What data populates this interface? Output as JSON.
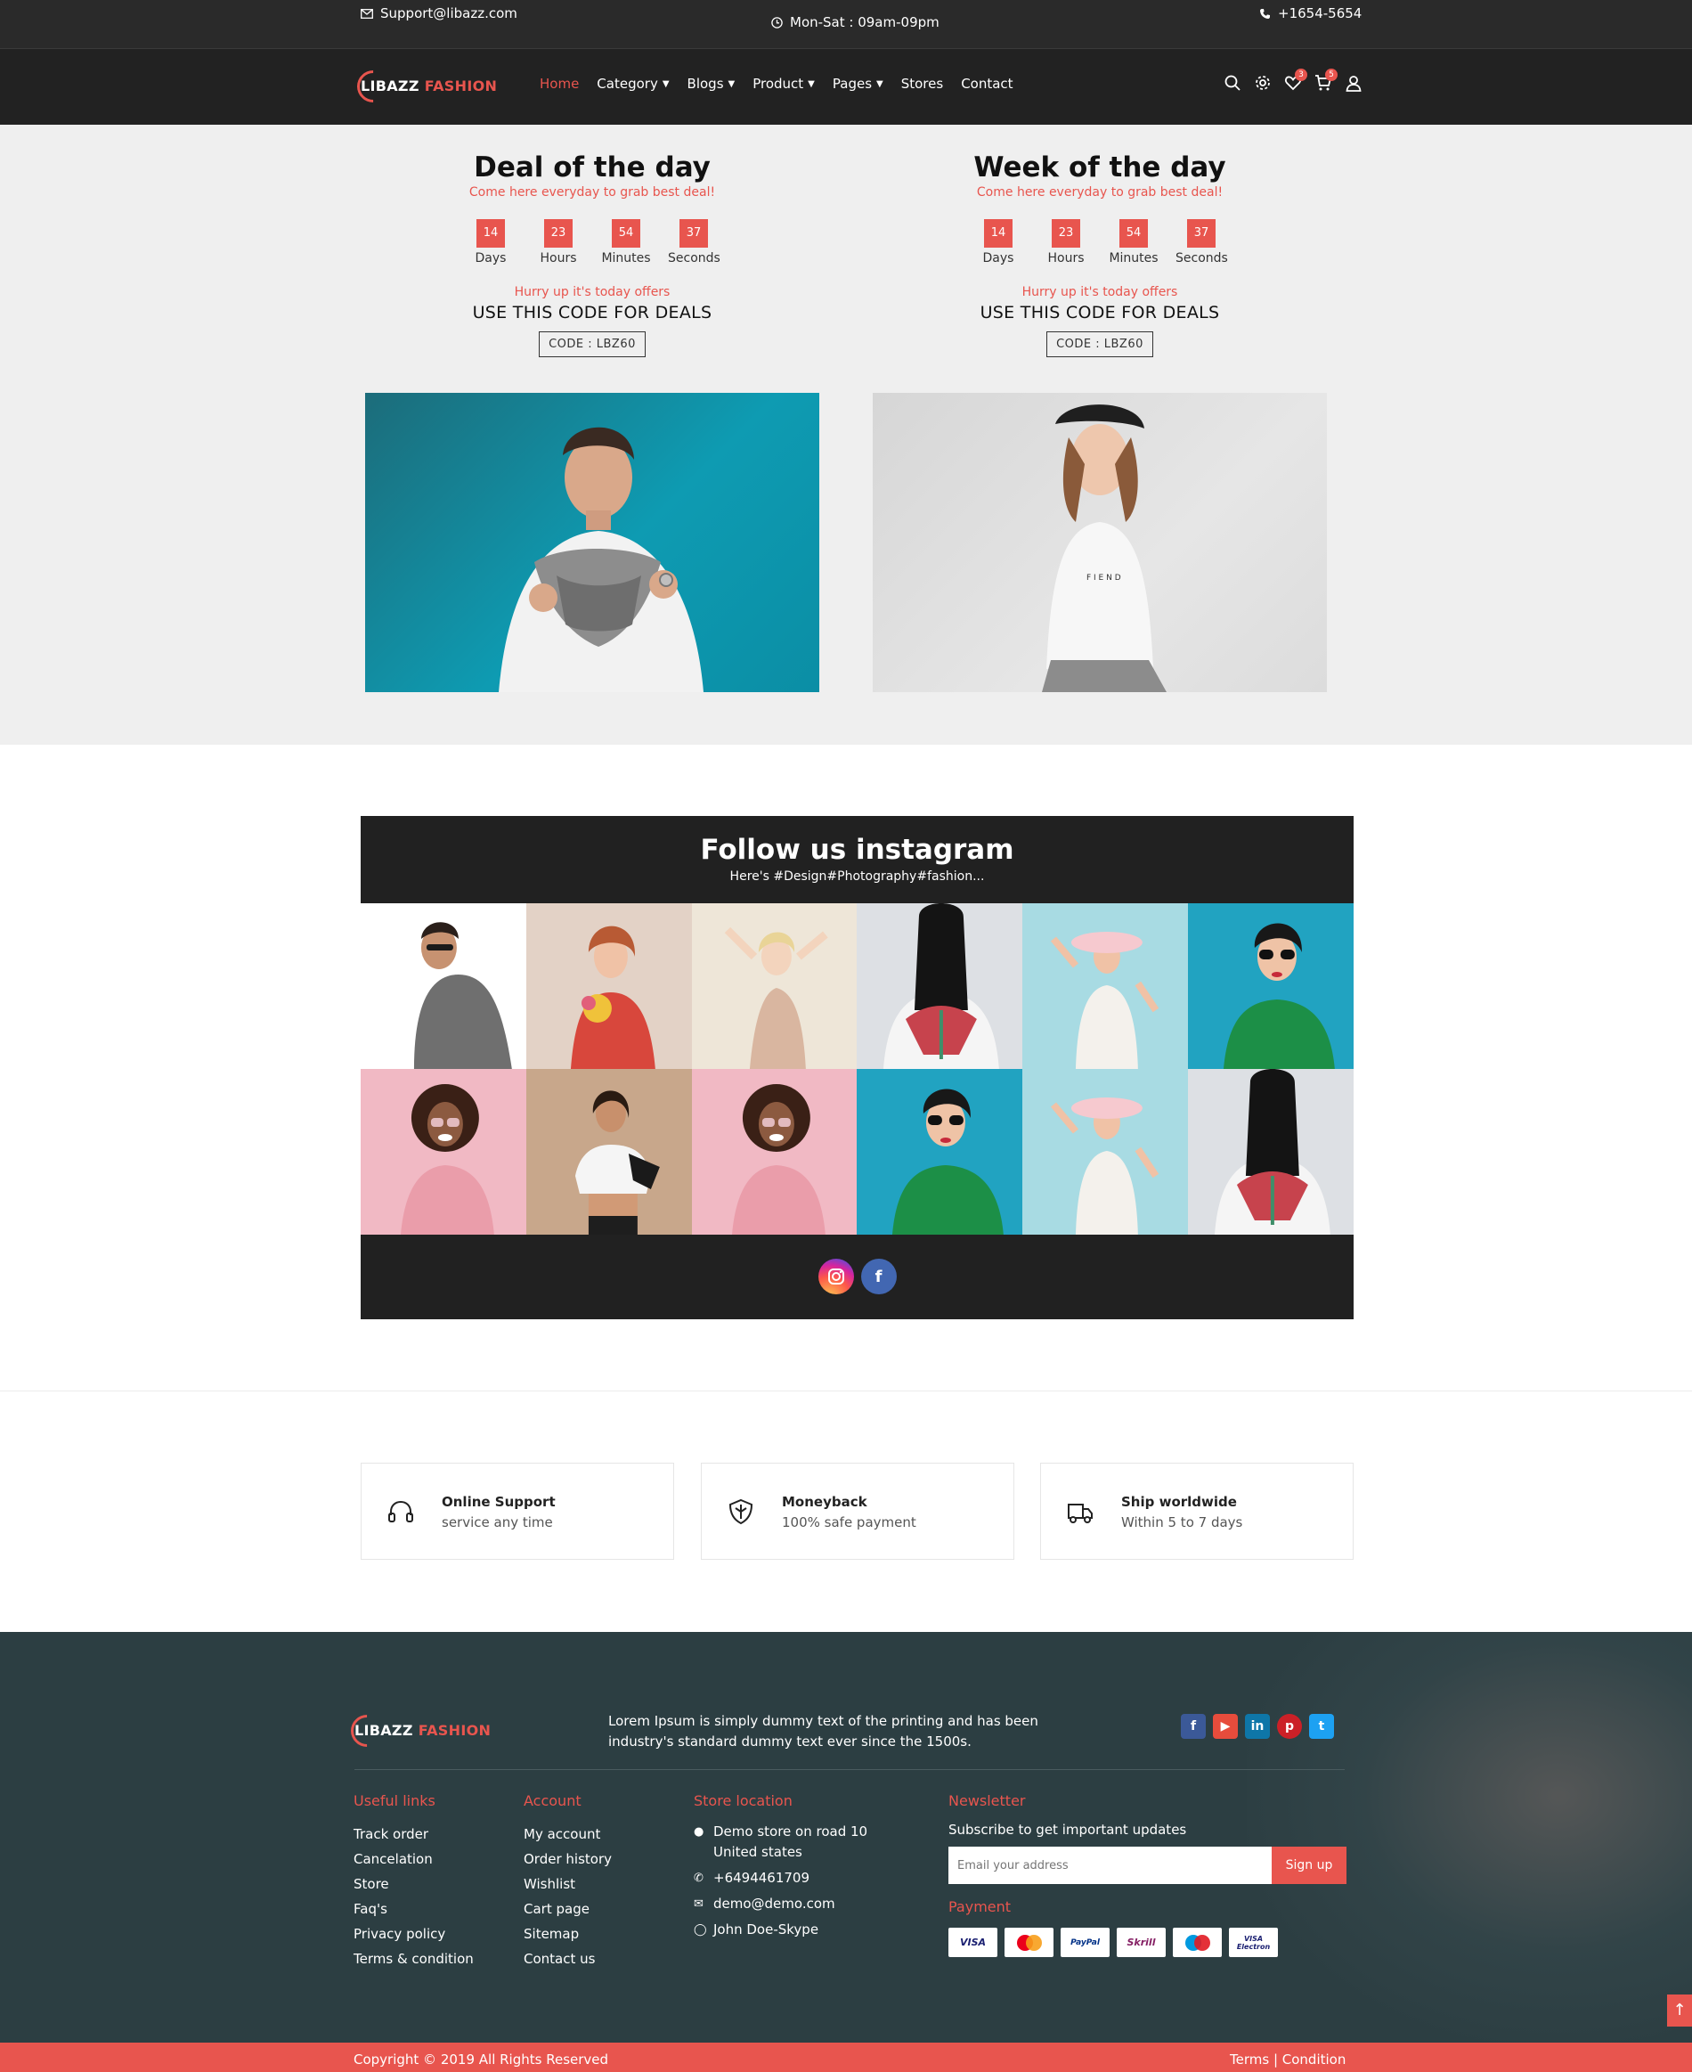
{
  "topbar": {
    "email": "Support@libazz.com",
    "hours": "Mon-Sat : 09am-09pm",
    "phone": "+1654-5654"
  },
  "brand": {
    "name_1": "LIBAZZ",
    "name_2": "FASHION"
  },
  "nav": {
    "items": [
      {
        "label": "Home",
        "active": true,
        "dropdown": false
      },
      {
        "label": "Category",
        "dropdown": true
      },
      {
        "label": "Blogs",
        "dropdown": true
      },
      {
        "label": "Product",
        "dropdown": true
      },
      {
        "label": "Pages",
        "dropdown": true
      },
      {
        "label": "Stores",
        "dropdown": false
      },
      {
        "label": "Contact",
        "dropdown": false
      }
    ],
    "wishlist_count": "3",
    "cart_count": "5",
    "icons": [
      "search-icon",
      "gear-icon",
      "heart-icon",
      "cart-icon",
      "user-icon"
    ]
  },
  "deals": [
    {
      "title": "Deal of the day",
      "subtitle": "Come here everyday to grab best deal!",
      "countdown": [
        {
          "value": "14",
          "label": "Days"
        },
        {
          "value": "23",
          "label": "Hours"
        },
        {
          "value": "54",
          "label": "Minutes"
        },
        {
          "value": "37",
          "label": "Seconds"
        }
      ],
      "hurry": "Hurry up it's today offers",
      "use_code": "USE THIS CODE FOR DEALS",
      "code": "CODE : LBZ60"
    },
    {
      "title": "Week of the day",
      "subtitle": "Come here everyday to grab best deal!",
      "countdown": [
        {
          "value": "14",
          "label": "Days"
        },
        {
          "value": "23",
          "label": "Hours"
        },
        {
          "value": "54",
          "label": "Minutes"
        },
        {
          "value": "37",
          "label": "Seconds"
        }
      ],
      "hurry": "Hurry up it's today offers",
      "use_code": "USE THIS CODE FOR DEALS",
      "code": "CODE : LBZ60"
    }
  ],
  "instagram": {
    "title": "Follow us instagram",
    "tagline": "Here's #Design#Photography#fashion..."
  },
  "features": [
    {
      "title": "Online Support",
      "subtitle": "service any time",
      "icon": "headphones-icon"
    },
    {
      "title": "Moneyback",
      "subtitle": "100% safe payment",
      "icon": "shield-icon"
    },
    {
      "title": "Ship worldwide",
      "subtitle": "Within 5 to 7 days",
      "icon": "truck-icon"
    }
  ],
  "footer": {
    "about": "Lorem Ipsum is simply dummy text of the printing and has been industry's standard dummy text ever since the 1500s.",
    "useful_links": {
      "heading": "Useful links",
      "items": [
        "Track order",
        "Cancelation",
        "Store",
        "Faq's",
        "Privacy policy",
        "Terms & condition"
      ]
    },
    "account": {
      "heading": "Account",
      "items": [
        "My account",
        "Order history",
        "Wishlist",
        "Cart page",
        "Sitemap",
        "Contact us"
      ]
    },
    "store_location": {
      "heading": "Store location",
      "address_line_1": "Demo store on road 10",
      "address_line_2": "United states",
      "phone": "+6494461709",
      "email": "demo@demo.com",
      "skype": "John Doe-Skype"
    },
    "newsletter": {
      "heading": "Newsletter",
      "subtitle": "Subscribe to get important updates",
      "placeholder": "Email your address",
      "button": "Sign up"
    },
    "payment": {
      "heading": "Payment",
      "methods": [
        "VISA",
        "mastercard",
        "PayPal",
        "Skrill",
        "Maestro",
        "VISA Electron"
      ]
    },
    "social": [
      "f",
      "yt",
      "in",
      "p",
      "t"
    ]
  },
  "copyright": {
    "left": "Copyright © 2019 All Rights Reserved",
    "right": "Terms | Condition"
  },
  "colors": {
    "accent": "#e8554e",
    "dark": "#222222",
    "footer_bg": "#2c3e42"
  }
}
